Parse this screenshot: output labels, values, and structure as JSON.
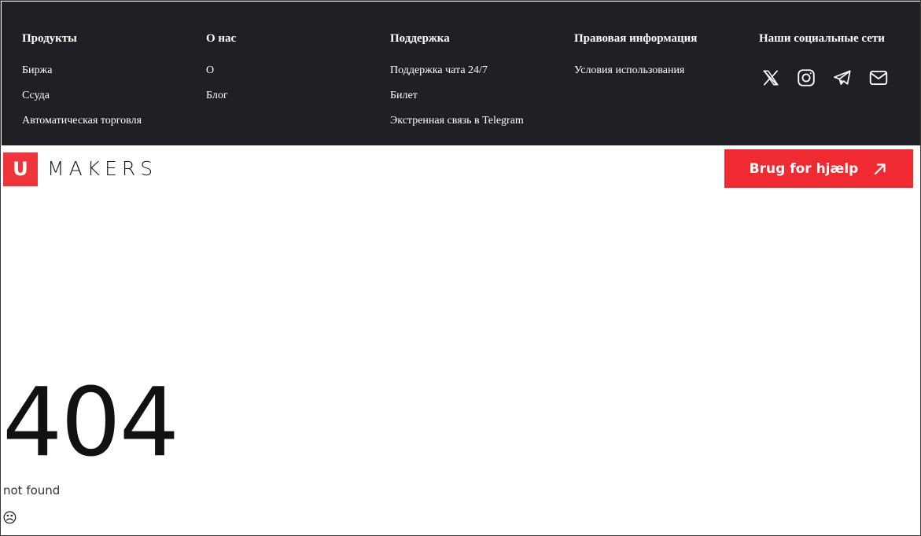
{
  "footer": {
    "columns": [
      {
        "title": "Продукты",
        "links": [
          "Биржа",
          "Ссуда",
          "Автоматическая торговля"
        ]
      },
      {
        "title": "О нас",
        "links": [
          "О",
          "Блог"
        ]
      },
      {
        "title": "Поддержка",
        "links": [
          "Поддержка чата 24/7",
          "Билет",
          "Экстренная связь в Telegram"
        ]
      },
      {
        "title": "Правовая информация",
        "links": [
          "Условия использования"
        ]
      },
      {
        "title": "Наши социальные сети",
        "links": []
      }
    ],
    "socials": [
      "x-icon",
      "instagram-icon",
      "telegram-icon",
      "mail-icon"
    ]
  },
  "header": {
    "logo_letter": "U",
    "logo_text": "MAKERS",
    "help_button": "Brug for hjælp",
    "accent_color": "#f02a31"
  },
  "error": {
    "code": "404",
    "message": "not found",
    "emoji": "☹"
  }
}
